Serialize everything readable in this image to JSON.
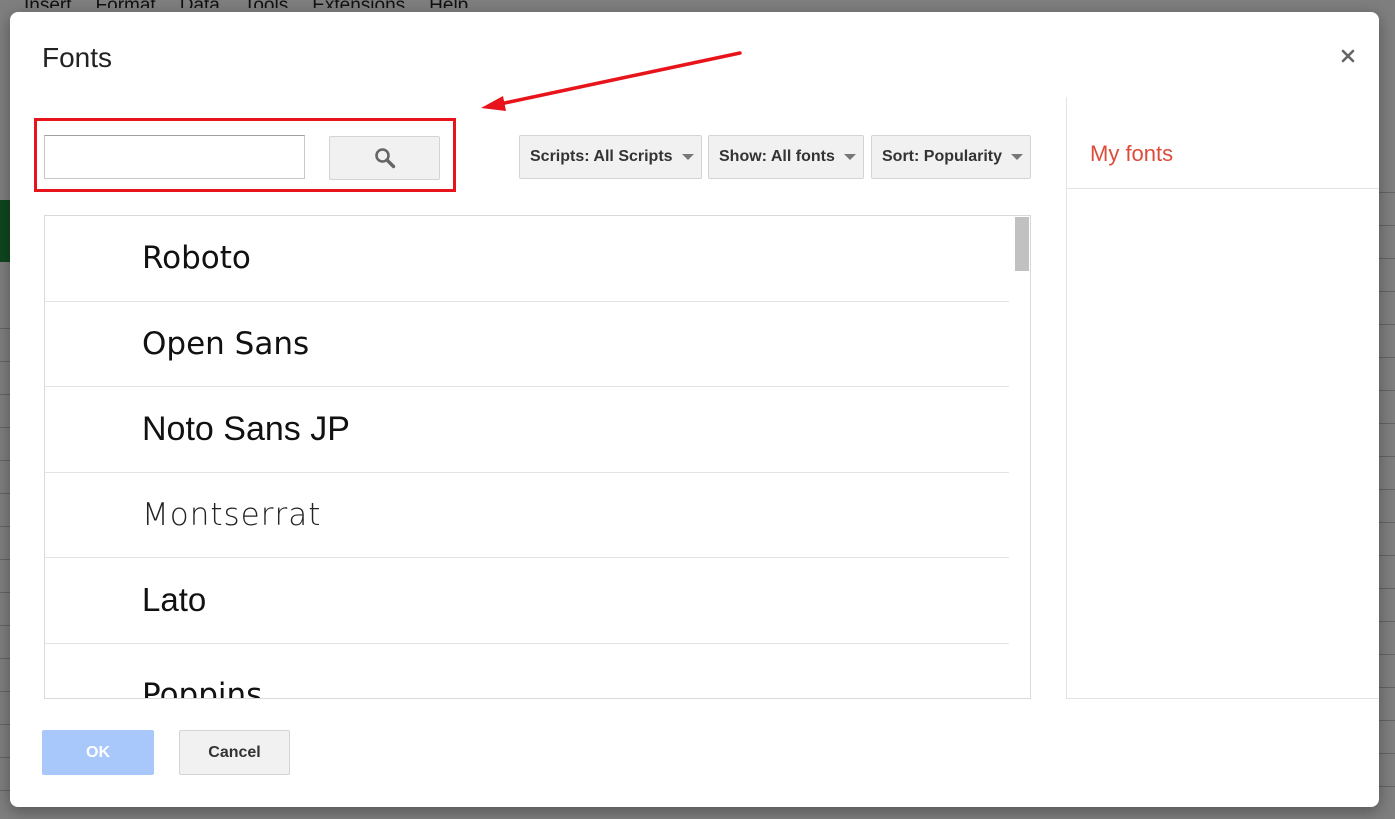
{
  "background_app": {
    "menu": [
      "Insert",
      "Format",
      "Data",
      "Tools",
      "Extensions",
      "Help"
    ]
  },
  "dialog": {
    "title": "Fonts",
    "close_icon": "close-icon",
    "search": {
      "value": "",
      "placeholder": "",
      "button_icon": "search-icon"
    },
    "filters": {
      "scripts_label": "Scripts: All Scripts",
      "show_label": "Show: All fonts",
      "sort_label": "Sort: Popularity"
    },
    "fonts": [
      "Roboto",
      "Open Sans",
      "Noto Sans JP",
      "Montserrat",
      "Lato",
      "Poppins"
    ],
    "side_panel": {
      "title": "My fonts"
    },
    "footer": {
      "ok_label": "OK",
      "cancel_label": "Cancel"
    }
  },
  "annotation": {
    "highlight_color": "#e8141b"
  },
  "colors": {
    "my_fonts": "#dd4b39",
    "ok_disabled": "#a8c8fb"
  }
}
